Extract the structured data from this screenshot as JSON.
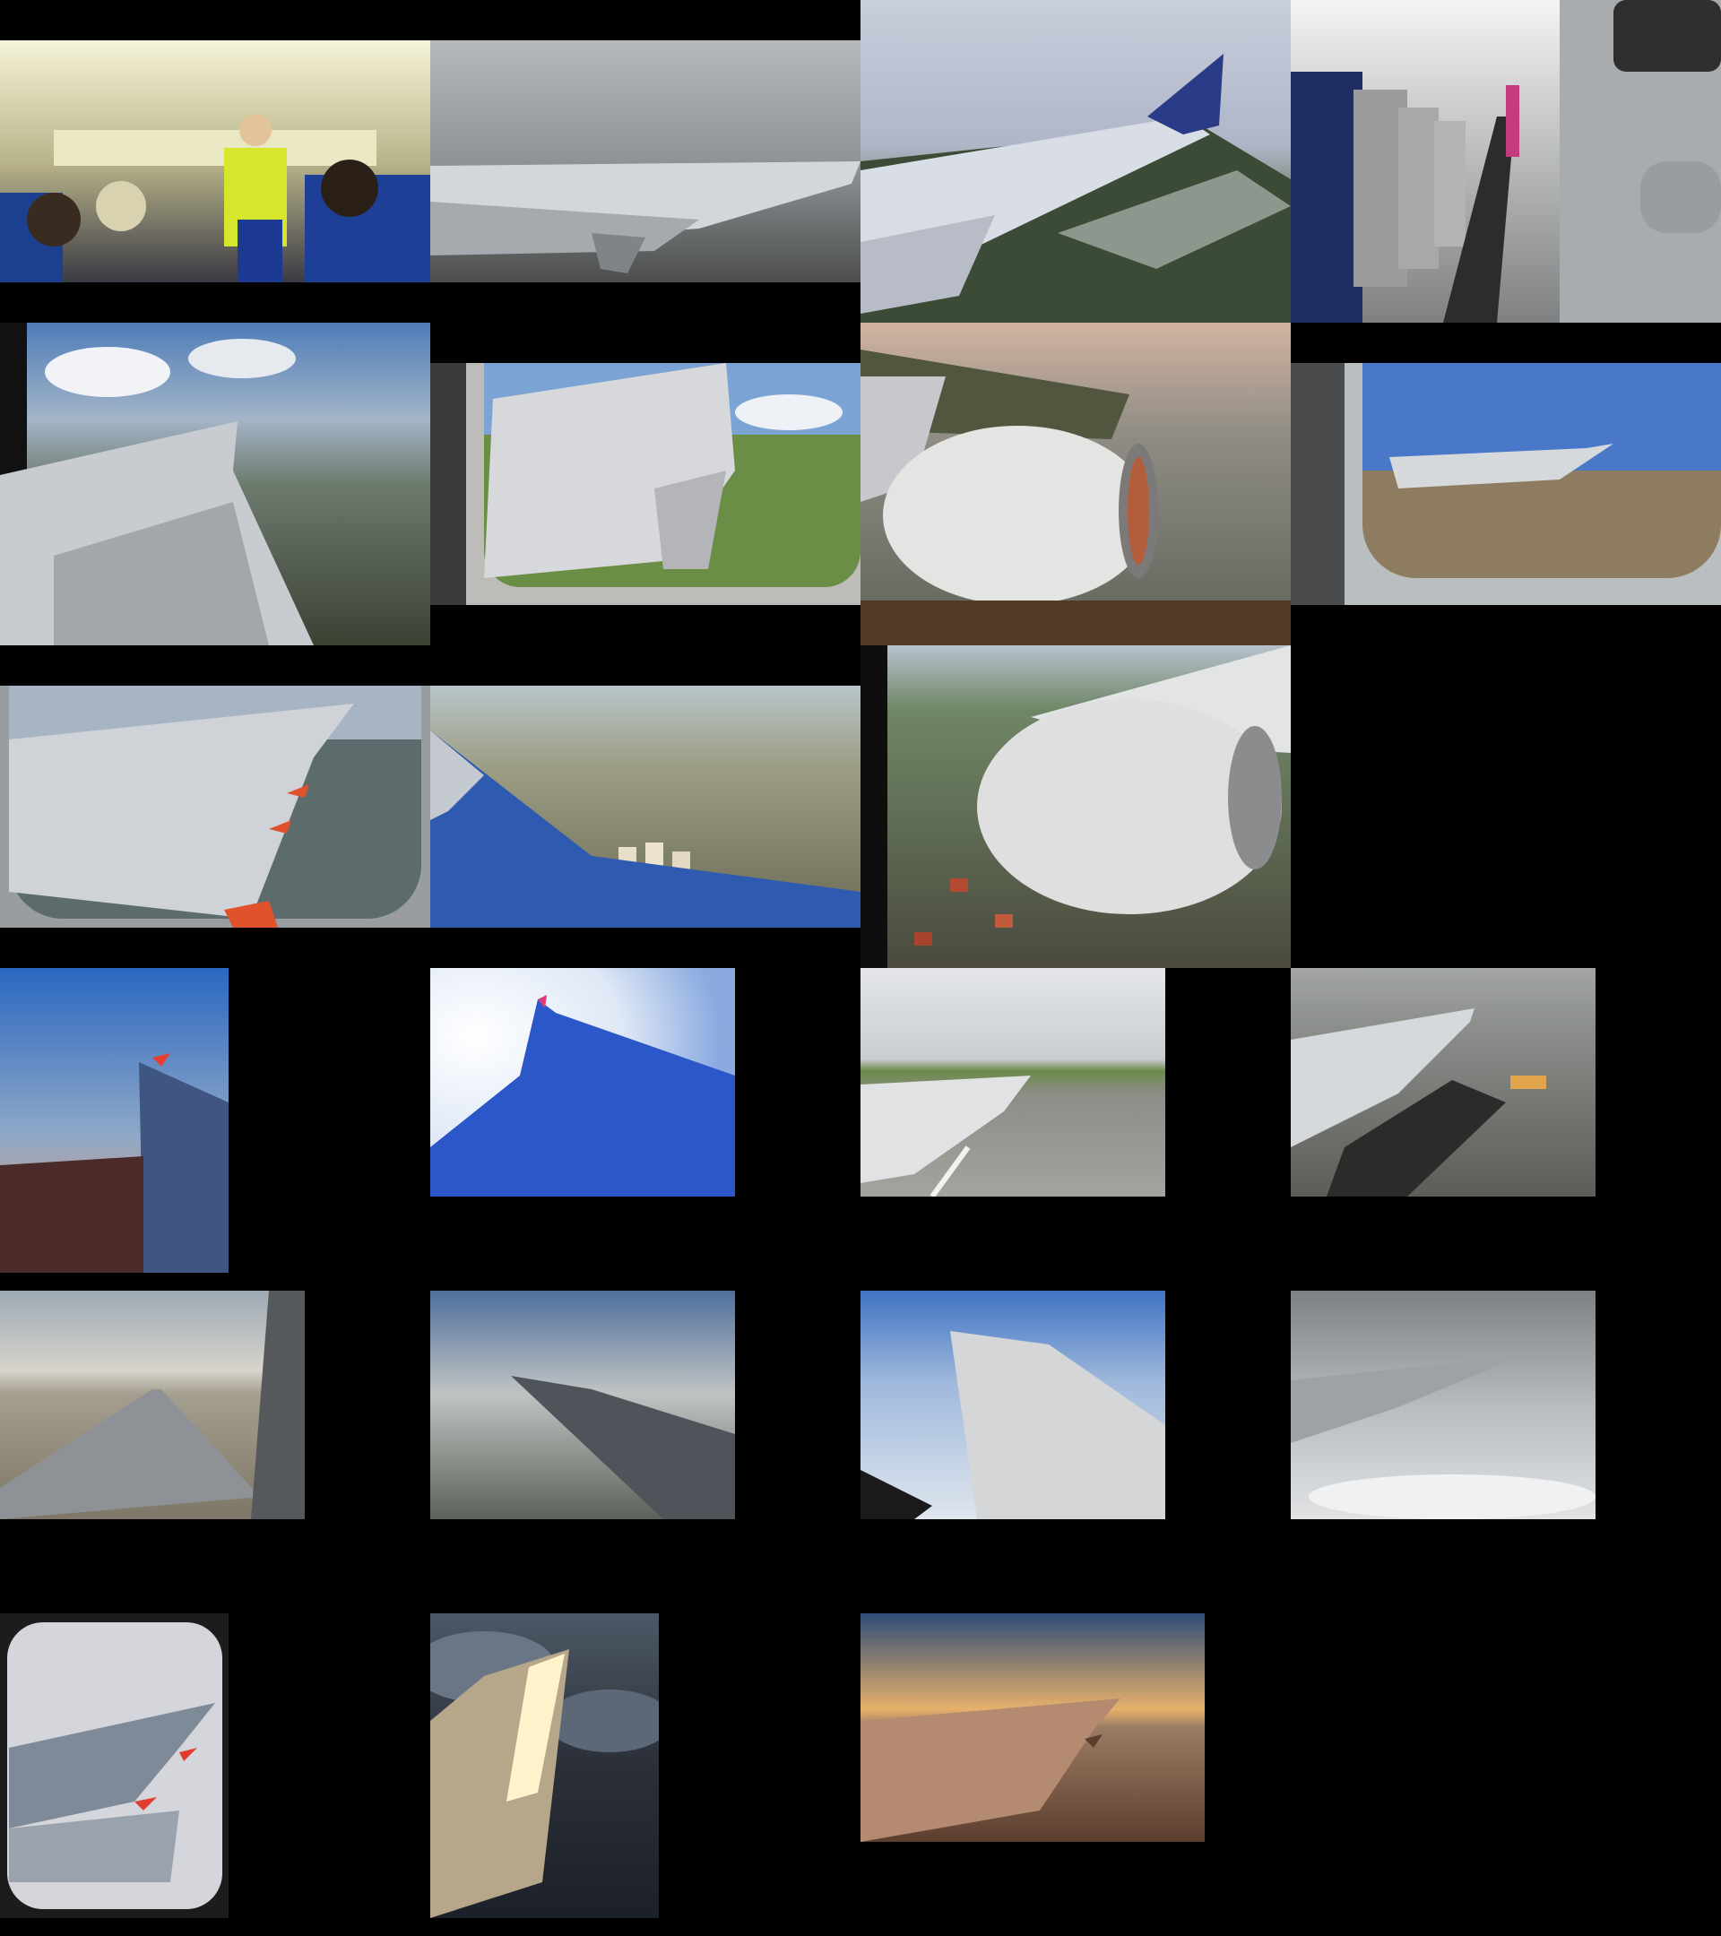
{
  "gallery": {
    "background": "#000000",
    "tiles": [
      {
        "id": "t1",
        "subject": "cabin-flight-attendant-safety-demo"
      },
      {
        "id": "t2",
        "subject": "wing-over-haze"
      },
      {
        "id": "t3",
        "subject": "wing-over-coast-blue-winglet"
      },
      {
        "id": "t4",
        "subject": "cabin-aisle-seats"
      },
      {
        "id": "t5",
        "subject": "wing-over-city"
      },
      {
        "id": "t6",
        "subject": "window-wing-over-hills"
      },
      {
        "id": "t7",
        "subject": "engine-over-coast-sunset"
      },
      {
        "id": "t8",
        "subject": "window-wing-over-desert"
      },
      {
        "id": "t9",
        "subject": "window-wing-orange-flaps"
      },
      {
        "id": "t10",
        "subject": "wing-over-city-apartments"
      },
      {
        "id": "t11",
        "subject": "engine-over-town"
      },
      {
        "id": "t12",
        "subject": "winglet-red-at-dusk"
      },
      {
        "id": "t13",
        "subject": "blue-wing-bright-sky"
      },
      {
        "id": "t14",
        "subject": "wing-on-runway"
      },
      {
        "id": "t15",
        "subject": "wing-on-taxiway"
      },
      {
        "id": "t16",
        "subject": "wing-over-desert-runway"
      },
      {
        "id": "t17",
        "subject": "wing-in-evening-sky"
      },
      {
        "id": "t18",
        "subject": "wing-over-clouds"
      },
      {
        "id": "t19",
        "subject": "wing-above-clouds-grey"
      },
      {
        "id": "t20",
        "subject": "window-wing-red-winglet"
      },
      {
        "id": "t21",
        "subject": "sunlit-wing-over-clouds"
      },
      {
        "id": "t22",
        "subject": "wing-at-sunset"
      }
    ]
  }
}
